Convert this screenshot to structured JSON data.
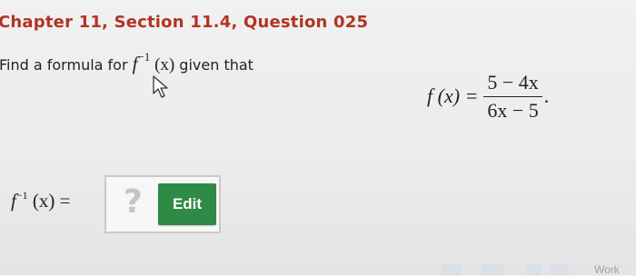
{
  "question": {
    "heading": "Chapter 11, Section 11.4, Question 025",
    "prompt_prefix": "Find a formula for ",
    "prompt_func": "f",
    "prompt_exp": "−1",
    "prompt_arg": " (x)",
    "prompt_suffix": " given that"
  },
  "given": {
    "lhs": "f (x) =",
    "numerator": "5 − 4x",
    "denominator": "6x − 5",
    "period": "."
  },
  "answer": {
    "label_func": "f",
    "label_exp": "−1",
    "label_rest": " (x) =",
    "placeholder": "?",
    "edit_label": "Edit"
  },
  "footer": {
    "partial_text": "Work"
  },
  "colors": {
    "heading": "#b23325",
    "edit_button": "#2f8a45"
  }
}
